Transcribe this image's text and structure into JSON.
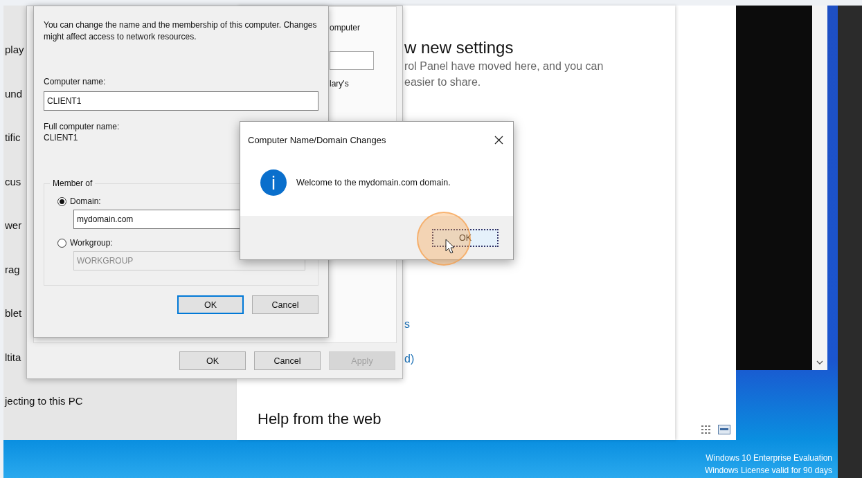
{
  "settings": {
    "sidebar_items": [
      "play",
      "und",
      "tific",
      "cus",
      "wer",
      "rag",
      "blet",
      "ltita",
      "jecting to this PC"
    ],
    "heading": "w new settings",
    "description": [
      "rol Panel have moved here, and you can",
      "easier to share."
    ],
    "links": [
      "s",
      "d)"
    ],
    "help_heading": "Help from the web"
  },
  "system_properties": {
    "fragments": [
      "omputer",
      "lary's"
    ],
    "buttons": [
      {
        "label": "OK",
        "disabled": false
      },
      {
        "label": "Cancel",
        "disabled": false
      },
      {
        "label": "Apply",
        "disabled": true
      }
    ]
  },
  "name_changes": {
    "intro": "You can change the name and the membership of this computer. Changes might affect access to network resources.",
    "computer_name_label": "Computer name:",
    "computer_name": "CLIENT1",
    "full_name_label": "Full computer name:",
    "full_name": "CLIENT1",
    "member_of": {
      "title": "Member of",
      "options": [
        {
          "label": "Domain:",
          "selected": true,
          "value": "mydomain.com"
        },
        {
          "label": "Workgroup:",
          "selected": false,
          "value": "WORKGROUP"
        }
      ]
    },
    "buttons": [
      {
        "label": "OK",
        "default": true
      },
      {
        "label": "Cancel",
        "default": false
      }
    ]
  },
  "message_box": {
    "title": "Computer Name/Domain Changes",
    "message": "Welcome to the mydomain.com domain.",
    "button": "OK"
  },
  "desktop_notice": [
    "Windows 10 Enterprise Evaluation",
    "Windows License valid for 90 days"
  ]
}
